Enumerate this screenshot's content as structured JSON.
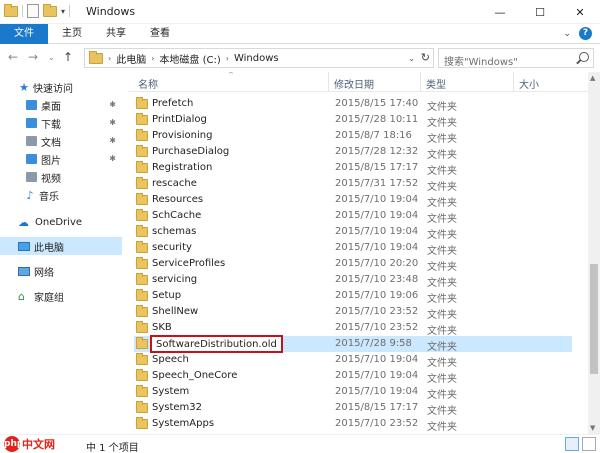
{
  "window": {
    "title": "Windows"
  },
  "window_controls": {
    "minimize": "—",
    "maximize": "☐",
    "close": "✕"
  },
  "ribbon": {
    "tabs": [
      "文件",
      "主页",
      "共享",
      "查看"
    ],
    "expand_glyph": "⌄",
    "help_glyph": "?"
  },
  "address": {
    "crumbs": [
      "此电脑",
      "本地磁盘 (C:)",
      "Windows"
    ],
    "separator": "›",
    "dropdown": "⌄",
    "refresh": "↻"
  },
  "nav_buttons": {
    "back": "←",
    "forward": "→",
    "recent": "⌄",
    "up": "↑"
  },
  "search": {
    "placeholder": "搜索\"Windows\""
  },
  "nav_pane": {
    "quick_access": "快速访问",
    "pinned": [
      {
        "label": "桌面",
        "icon": "desktop-icon"
      },
      {
        "label": "下载",
        "icon": "download-icon"
      },
      {
        "label": "文档",
        "icon": "document-icon"
      },
      {
        "label": "图片",
        "icon": "picture-icon"
      }
    ],
    "folders": [
      {
        "label": "视频",
        "icon": "video-icon"
      },
      {
        "label": "音乐",
        "icon": "music-icon"
      }
    ],
    "onedrive": "OneDrive",
    "this_pc": "此电脑",
    "network": "网络",
    "homegroup": "家庭组",
    "pin_glyph": "✱",
    "star_glyph": "★",
    "cloud_glyph": "☁",
    "music_glyph": "♪",
    "home_glyph": "⌂"
  },
  "columns": {
    "name": "名称",
    "date": "修改日期",
    "type": "类型",
    "size": "大小",
    "sort_caret": "^"
  },
  "files": [
    {
      "name": "Prefetch",
      "date": "2015/8/15 17:40",
      "type": "文件夹"
    },
    {
      "name": "PrintDialog",
      "date": "2015/7/28 10:11",
      "type": "文件夹"
    },
    {
      "name": "Provisioning",
      "date": "2015/8/7 18:16",
      "type": "文件夹"
    },
    {
      "name": "PurchaseDialog",
      "date": "2015/7/28 12:32",
      "type": "文件夹"
    },
    {
      "name": "Registration",
      "date": "2015/8/15 17:17",
      "type": "文件夹"
    },
    {
      "name": "rescache",
      "date": "2015/7/31 17:52",
      "type": "文件夹"
    },
    {
      "name": "Resources",
      "date": "2015/7/10 19:04",
      "type": "文件夹"
    },
    {
      "name": "SchCache",
      "date": "2015/7/10 19:04",
      "type": "文件夹"
    },
    {
      "name": "schemas",
      "date": "2015/7/10 19:04",
      "type": "文件夹"
    },
    {
      "name": "security",
      "date": "2015/7/10 19:04",
      "type": "文件夹"
    },
    {
      "name": "ServiceProfiles",
      "date": "2015/7/10 20:20",
      "type": "文件夹"
    },
    {
      "name": "servicing",
      "date": "2015/7/10 23:48",
      "type": "文件夹"
    },
    {
      "name": "Setup",
      "date": "2015/7/10 19:06",
      "type": "文件夹"
    },
    {
      "name": "ShellNew",
      "date": "2015/7/10 23:52",
      "type": "文件夹"
    },
    {
      "name": "SKB",
      "date": "2015/7/10 23:52",
      "type": "文件夹"
    },
    {
      "name": "SoftwareDistribution.old",
      "date": "2015/7/28 9:58",
      "type": "文件夹",
      "selected": true,
      "renaming": true
    },
    {
      "name": "Speech",
      "date": "2015/7/10 19:04",
      "type": "文件夹"
    },
    {
      "name": "Speech_OneCore",
      "date": "2015/7/10 19:04",
      "type": "文件夹"
    },
    {
      "name": "System",
      "date": "2015/7/10 19:04",
      "type": "文件夹"
    },
    {
      "name": "System32",
      "date": "2015/8/15 17:17",
      "type": "文件夹"
    },
    {
      "name": "SystemApps",
      "date": "2015/7/10 23:52",
      "type": "文件夹"
    }
  ],
  "scrollbar": {
    "up": "▲",
    "down": "▼"
  },
  "status": {
    "text": "中 1 个项目"
  },
  "watermark": {
    "logo": "php",
    "text": "中文网"
  },
  "colors": {
    "accent": "#1979ca",
    "selection": "#cce8ff",
    "rename_border": "#c0141a",
    "folder": "#ecc35d"
  }
}
